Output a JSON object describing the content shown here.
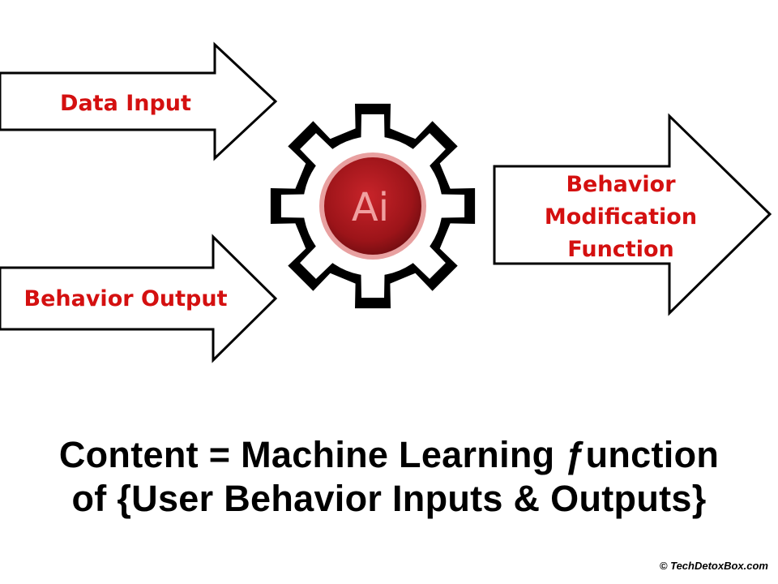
{
  "inputs": {
    "data_input_label": "Data Input",
    "behavior_output_label": "Behavior Output"
  },
  "engine": {
    "icon_text": "Ai",
    "icon": "gear-icon"
  },
  "output": {
    "lines": [
      "Behavior",
      "Modification",
      "Function"
    ]
  },
  "equation": {
    "line1": "Content = Machine Learning ƒunction",
    "line2": "of {User Behavior Inputs & Outputs}"
  },
  "copyright": "© TechDetoxBox.com",
  "colors": {
    "label_red": "#d41010",
    "badge_red": "#a3171b",
    "badge_ring": "#e8a0a0",
    "outline": "#000000"
  }
}
